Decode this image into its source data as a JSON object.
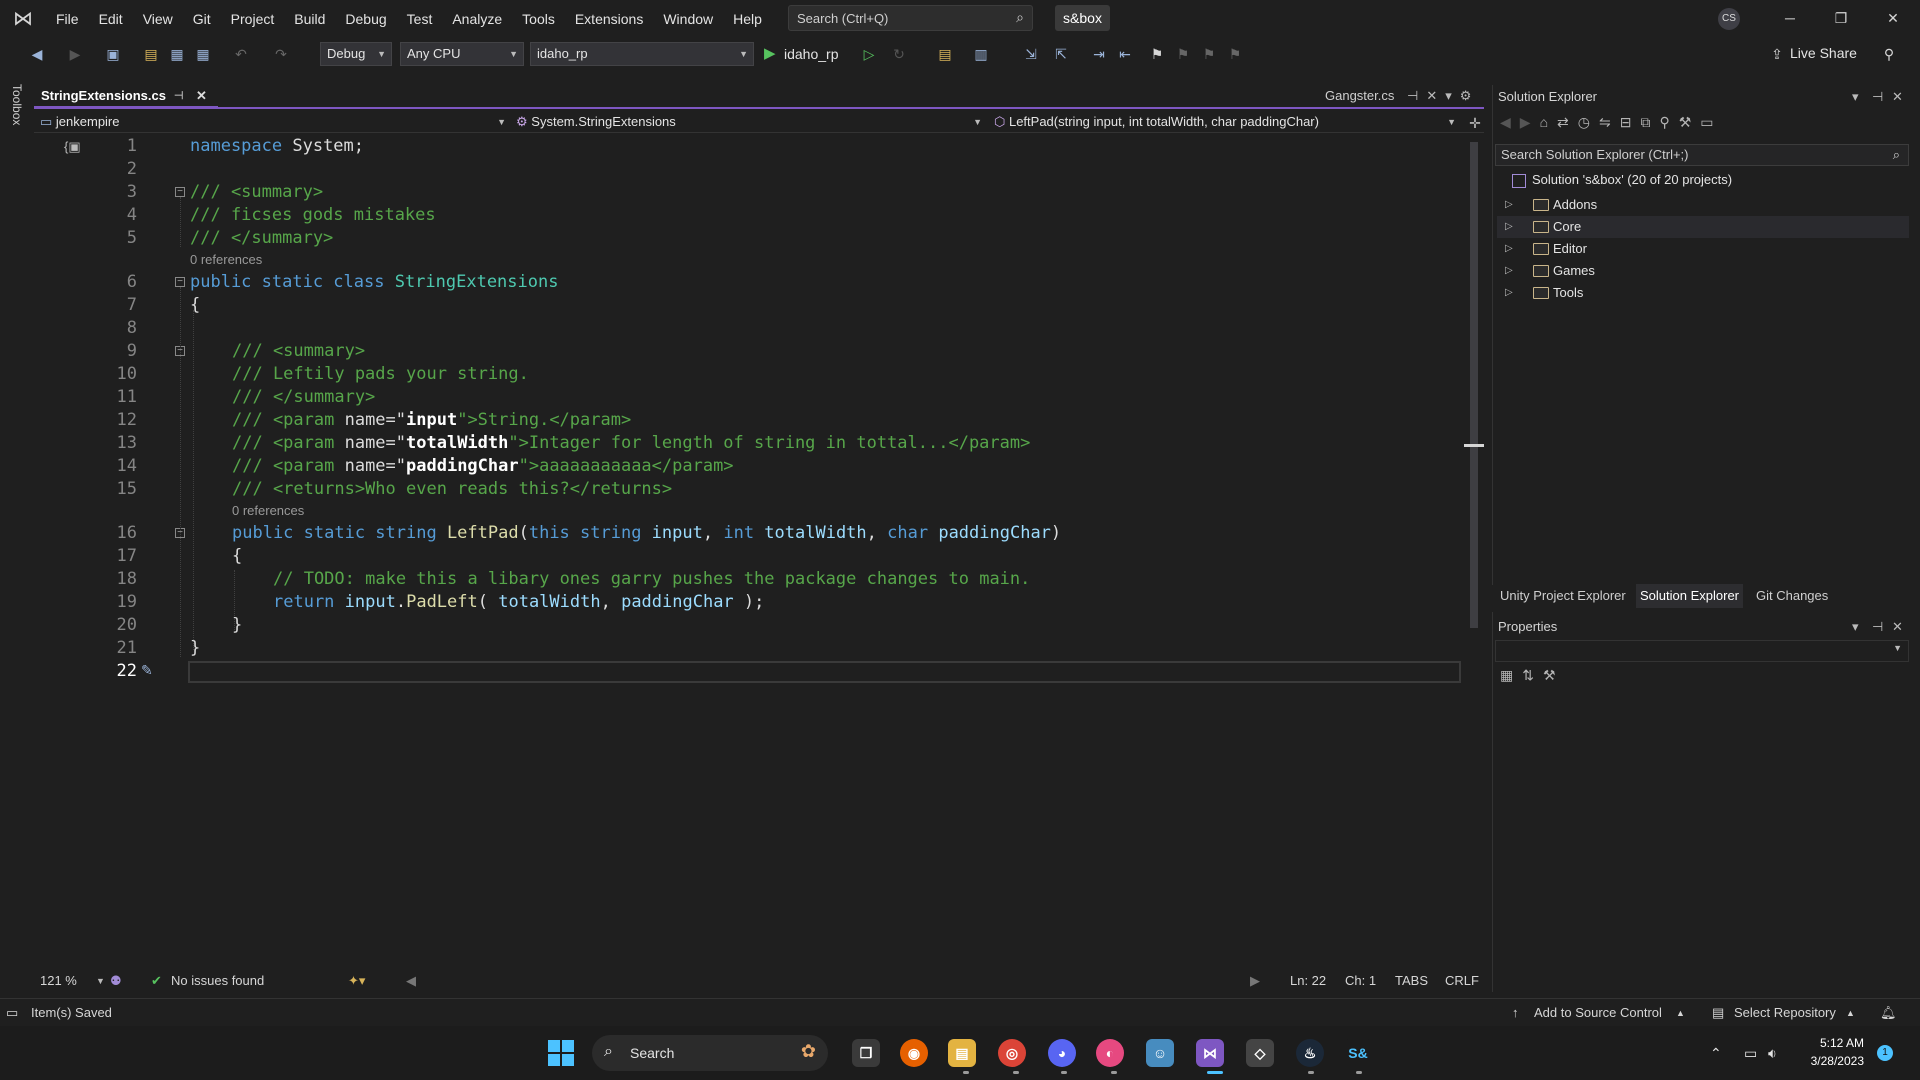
{
  "app": {
    "logo_icon": "visual-studio-logo-icon",
    "solution_name": "s&box",
    "user_initials": "CS"
  },
  "menu": [
    "File",
    "Edit",
    "View",
    "Git",
    "Project",
    "Build",
    "Debug",
    "Test",
    "Analyze",
    "Tools",
    "Extensions",
    "Window",
    "Help"
  ],
  "quick_search": {
    "placeholder": "Search (Ctrl+Q)"
  },
  "toolbar": {
    "config": "Debug",
    "platform": "Any CPU",
    "startup_project": "idaho_rp",
    "run_target": "idaho_rp",
    "live_share": "Live Share"
  },
  "toolbox_label": "Toolbox",
  "tabs": {
    "active": "StringExtensions.cs",
    "other": "Gangster.cs"
  },
  "navbar": {
    "project": "jenkempire",
    "type": "System.StringExtensions",
    "member": "LeftPad(string input, int totalWidth, char paddingChar)"
  },
  "code": {
    "line_numbers": [
      "1",
      "2",
      "3",
      "4",
      "5",
      "6",
      "7",
      "8",
      "9",
      "10",
      "11",
      "12",
      "13",
      "14",
      "15",
      "16",
      "17",
      "18",
      "19",
      "20",
      "21",
      "22"
    ],
    "references_label": "0 references",
    "l1_kw": "namespace",
    "l1_rest": " System;",
    "l3": "/// <summary>",
    "l4": "/// ficses gods mistakes",
    "l5": "/// </summary>",
    "l6_kw": "public static class ",
    "l6_type": "StringExtensions",
    "l7": "{",
    "l9": "/// <summary>",
    "l10": "/// Leftily pads your string.",
    "l11": "/// </summary>",
    "l12_a": "/// <param ",
    "l12_b": "name=\"",
    "l12_c": "input",
    "l12_d": "\">String.</param>",
    "l13_a": "/// <param ",
    "l13_b": "name=\"",
    "l13_c": "totalWidth",
    "l13_d": "\">Intager for length of string in tottal...</param>",
    "l14_a": "/// <param ",
    "l14_b": "name=\"",
    "l14_c": "paddingChar",
    "l14_d": "\">aaaaaaaaaaa</param>",
    "l15": "/// <returns>Who even reads this?</returns>",
    "l16_kw1": "public static string ",
    "l16_fn": "LeftPad",
    "l16_p1": "(",
    "l16_kw2": "this string ",
    "l16_id1": "input",
    "l16_p2": ", ",
    "l16_kw3": "int ",
    "l16_id2": "totalWidth",
    "l16_p3": ", ",
    "l16_kw4": "char ",
    "l16_id3": "paddingChar",
    "l16_p4": ")",
    "l17": "{",
    "l18": "// TODO: make this a libary ones garry pushes the package changes to main.",
    "l19_kw": "return ",
    "l19_id1": "input",
    "l19_p1": ".",
    "l19_fn": "PadLeft",
    "l19_p2": "( ",
    "l19_id2": "totalWidth",
    "l19_p3": ", ",
    "l19_id3": "paddingChar",
    "l19_p4": " );",
    "l20": "}",
    "l21": "}"
  },
  "editor_status": {
    "zoom": "121 %",
    "issues": "No issues found",
    "ln": "Ln: 22",
    "ch": "Ch: 1",
    "tabs": "TABS",
    "eol": "CRLF"
  },
  "solution_explorer": {
    "title": "Solution Explorer",
    "search_placeholder": "Search Solution Explorer (Ctrl+;)",
    "solution_label": "Solution 's&box' (20 of 20 projects)",
    "folders": [
      "Addons",
      "Core",
      "Editor",
      "Games",
      "Tools"
    ],
    "bottom_tabs": [
      "Unity Project Explorer",
      "Solution Explorer",
      "Git Changes"
    ]
  },
  "properties": {
    "title": "Properties"
  },
  "statusbar": {
    "message": "Item(s) Saved",
    "source_control": "Add to Source Control",
    "repository": "Select Repository"
  },
  "taskbar": {
    "search": "Search",
    "time": "5:12 AM",
    "date": "3/28/2023",
    "notifications": "1"
  }
}
